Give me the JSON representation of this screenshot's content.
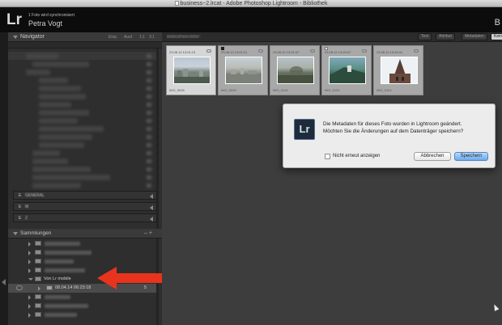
{
  "window": {
    "title": "business~2.lrcat - Adobe Photoshop Lightroom - Bibliothek"
  },
  "identity": {
    "logo": "Lr",
    "sync_status": "1 Foto wird synchronisiert",
    "user_name": "Petra Vogt",
    "module_partial": "B"
  },
  "left_panel": {
    "navigator_label": "Navigator",
    "zoom_options": [
      "Einp.",
      "Ausf.",
      "1:1",
      "3:1"
    ],
    "sources": [
      {
        "label": "E",
        "text": "GENERAL"
      },
      {
        "label": "E",
        "text": "M"
      },
      {
        "label": "E",
        "text": "Z"
      }
    ],
    "collections_label": "Sammlungen",
    "collections_actions": "– +",
    "mobile_collection": "Von Lr mobile",
    "mobile_set": "08.04.14 06:23:18",
    "mobile_set_count": "5"
  },
  "toolbar": {
    "filter_label": "Bibliotheksfilter:",
    "buttons": [
      "Text",
      "Attribut",
      "Metadaten",
      "Kein"
    ]
  },
  "grid": {
    "cells": [
      {
        "date": "23.08.12 13:01:13",
        "name": "IMG_5098",
        "selected": true
      },
      {
        "date": "23.08.12 13:01:21",
        "name": "IMG_5099",
        "selected": false
      },
      {
        "date": "23.08.12 13:01:47",
        "name": "IMG_5100",
        "selected": false
      },
      {
        "date": "23.08.12 13:03:47",
        "name": "IMG_5101",
        "selected": false
      },
      {
        "date": "23.08.12 13:26:41",
        "name": "IMG_5102",
        "selected": false
      }
    ]
  },
  "dialog": {
    "icon_text": "Lr",
    "message_line1": "Die Metadaten für dieses Foto wurden in Lightroom geändert.",
    "message_line2": "Möchten Sie die Änderungen auf dem Datenträger speichern?",
    "checkbox_label": "Nicht erneut anzeigen",
    "cancel_label": "Abbrechen",
    "save_label": "Speichern"
  }
}
